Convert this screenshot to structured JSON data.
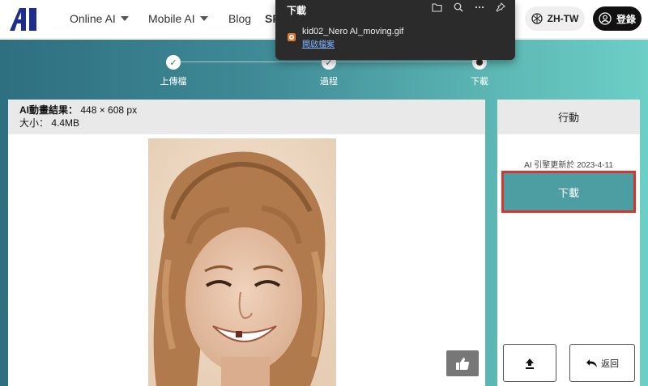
{
  "nav": {
    "items": [
      {
        "label": "Online AI",
        "has_dropdown": true
      },
      {
        "label": "Mobile AI",
        "has_dropdown": true
      },
      {
        "label": "Blog",
        "has_dropdown": false
      },
      {
        "label": "SP"
      }
    ],
    "language_label": "ZH-TW",
    "login_label": "登錄"
  },
  "download_popup": {
    "title": "下載",
    "file_name": "kid02_Nero AI_moving.gif",
    "open_file_label": "開啟檔案",
    "tools": [
      "folder-icon",
      "search-icon",
      "more-icon",
      "pin-icon"
    ]
  },
  "steps": [
    {
      "label": "上傳檔",
      "state": "done"
    },
    {
      "label": "過程",
      "state": "done"
    },
    {
      "label": "下載",
      "state": "current"
    }
  ],
  "result": {
    "result_label": "AI動畫結果：",
    "result_value": "448 × 608 px",
    "size_label": "大小：",
    "size_value": "4.4MB"
  },
  "action": {
    "title": "行動",
    "engine_note": "AI 引擎更新於 2023-4-11",
    "download_label": "下載",
    "back_label": "返回"
  },
  "colors": {
    "accent": "#4d9ea3",
    "highlight": "#d9332b",
    "gradient_start": "#2e6f80",
    "gradient_end": "#6ccfc6"
  }
}
